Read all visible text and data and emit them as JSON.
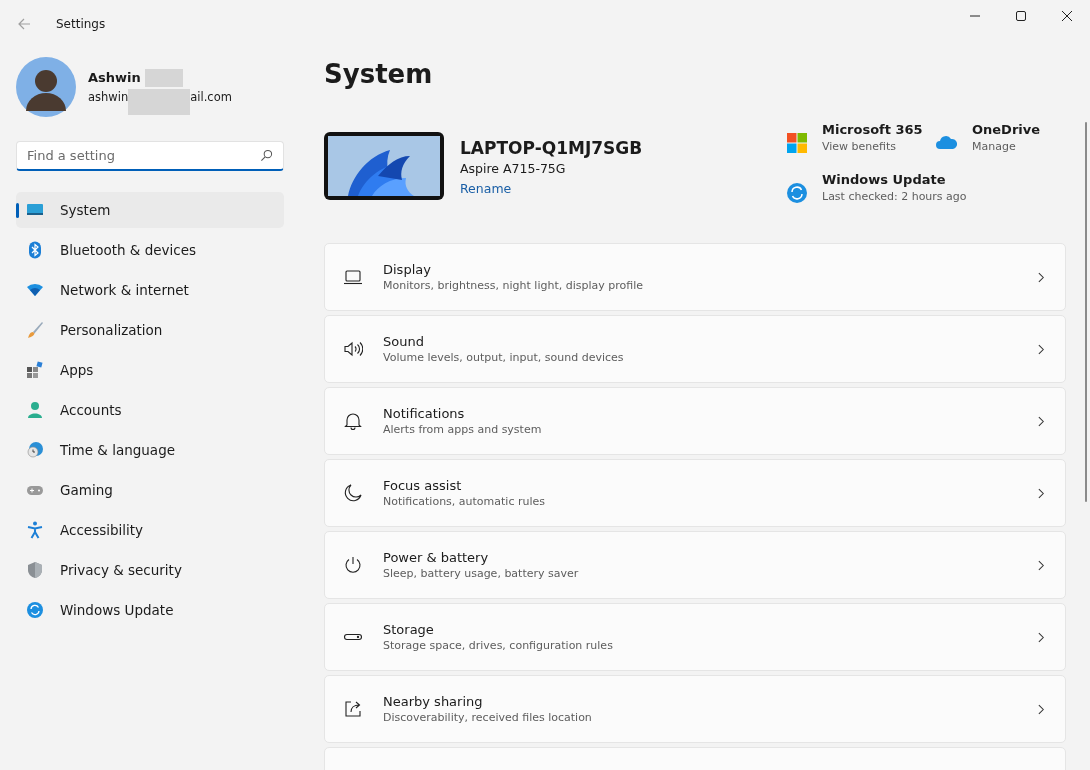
{
  "window": {
    "title": "Settings"
  },
  "profile": {
    "name": "Ashwin",
    "email_start": "ashwin",
    "email_end": "ail.com"
  },
  "search": {
    "placeholder": "Find a setting"
  },
  "sidebar": {
    "items": [
      {
        "label": "System",
        "selected": true
      },
      {
        "label": "Bluetooth & devices",
        "selected": false
      },
      {
        "label": "Network & internet",
        "selected": false
      },
      {
        "label": "Personalization",
        "selected": false
      },
      {
        "label": "Apps",
        "selected": false
      },
      {
        "label": "Accounts",
        "selected": false
      },
      {
        "label": "Time & language",
        "selected": false
      },
      {
        "label": "Gaming",
        "selected": false
      },
      {
        "label": "Accessibility",
        "selected": false
      },
      {
        "label": "Privacy & security",
        "selected": false
      },
      {
        "label": "Windows Update",
        "selected": false
      }
    ]
  },
  "page": {
    "title": "System",
    "device": {
      "name": "LAPTOP-Q1MJ7SGB",
      "model": "Aspire A715-75G",
      "rename": "Rename"
    },
    "quick_links": [
      {
        "title": "Microsoft 365",
        "subtitle": "View benefits"
      },
      {
        "title": "OneDrive",
        "subtitle": "Manage"
      },
      {
        "title": "Windows Update",
        "subtitle": "Last checked: 2 hours ago"
      }
    ],
    "cards": [
      {
        "title": "Display",
        "subtitle": "Monitors, brightness, night light, display profile"
      },
      {
        "title": "Sound",
        "subtitle": "Volume levels, output, input, sound devices"
      },
      {
        "title": "Notifications",
        "subtitle": "Alerts from apps and system"
      },
      {
        "title": "Focus assist",
        "subtitle": "Notifications, automatic rules"
      },
      {
        "title": "Power & battery",
        "subtitle": "Sleep, battery usage, battery saver"
      },
      {
        "title": "Storage",
        "subtitle": "Storage space, drives, configuration rules"
      },
      {
        "title": "Nearby sharing",
        "subtitle": "Discoverability, received files location"
      }
    ],
    "more_below": true
  }
}
